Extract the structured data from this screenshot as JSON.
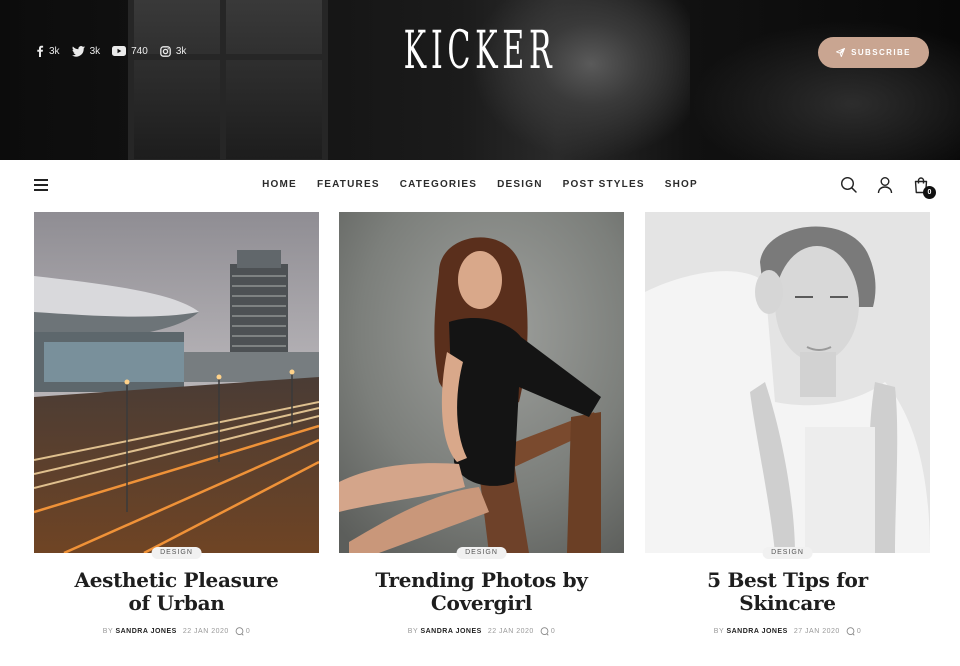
{
  "brand": {
    "logo": "KICKER"
  },
  "social": [
    {
      "icon": "facebook-icon",
      "count": "3k"
    },
    {
      "icon": "twitter-icon",
      "count": "3k"
    },
    {
      "icon": "youtube-icon",
      "count": "740"
    },
    {
      "icon": "instagram-icon",
      "count": "3k"
    }
  ],
  "header": {
    "subscribe_label": "SUBSCRIBE",
    "accent_color": "#c9a591"
  },
  "nav": {
    "links": [
      "HOME",
      "FEATURES",
      "CATEGORIES",
      "DESIGN",
      "POST STYLES",
      "SHOP"
    ],
    "cart_count": "0"
  },
  "posts": [
    {
      "category": "DESIGN",
      "title": "Aesthetic Pleasure of Urban",
      "by": "BY",
      "author": "SANDRA JONES",
      "date": "22 JAN 2020",
      "comments": "0"
    },
    {
      "category": "DESIGN",
      "title": "Trending Photos by Covergirl",
      "by": "BY",
      "author": "SANDRA JONES",
      "date": "22 JAN 2020",
      "comments": "0"
    },
    {
      "category": "DESIGN",
      "title": "5 Best Tips for Skincare",
      "by": "BY",
      "author": "SANDRA JONES",
      "date": "27 JAN 2020",
      "comments": "0"
    }
  ]
}
